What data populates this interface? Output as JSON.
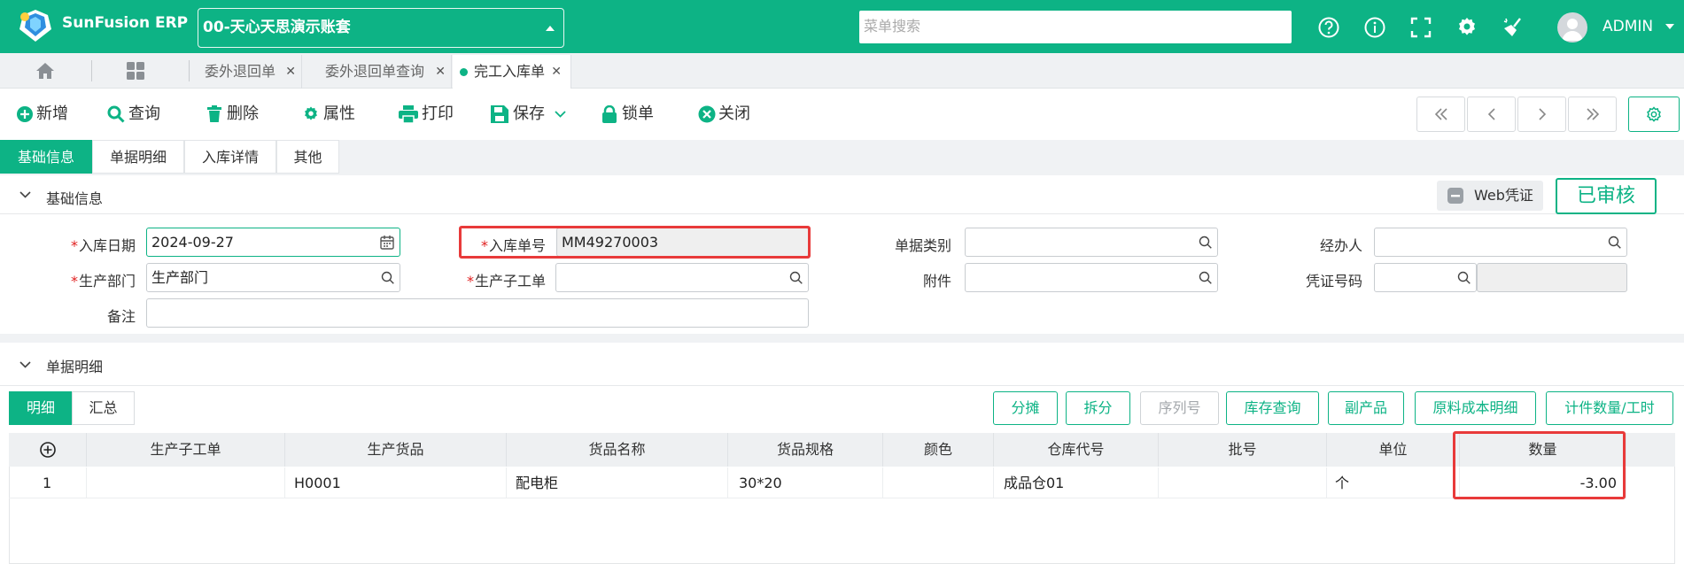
{
  "app": {
    "name": "SunFusion ERP",
    "account": "00-天心天思演示账套"
  },
  "search": {
    "placeholder": "菜单搜索"
  },
  "user": {
    "name": "ADMIN"
  },
  "tabs": [
    {
      "label": "委外退回单"
    },
    {
      "label": "委外退回单查询"
    },
    {
      "label": "完工入库单"
    }
  ],
  "toolbar": {
    "add": "新增",
    "query": "查询",
    "delete": "删除",
    "props": "属性",
    "print": "打印",
    "save": "保存",
    "lock": "锁单",
    "close": "关闭"
  },
  "section_tabs": [
    "基础信息",
    "单据明细",
    "入库详情",
    "其他"
  ],
  "basic": {
    "title": "基础信息",
    "web_voucher": "Web凭证",
    "status": "已审核",
    "labels": {
      "date": "入库日期",
      "order_no": "入库单号",
      "doc_type": "单据类别",
      "handler": "经办人",
      "dept": "生产部门",
      "sub_order": "生产子工单",
      "attachment": "附件",
      "voucher_no": "凭证号码",
      "remark": "备注"
    },
    "values": {
      "date": "2024-09-27",
      "order_no": "MM49270003",
      "doc_type": "",
      "handler": "",
      "dept": "生产部门",
      "sub_order": "",
      "attachment": "",
      "voucher_no": "",
      "remark": ""
    },
    "required_mark": "*"
  },
  "detail": {
    "title": "单据明细",
    "tabs": [
      "明细",
      "汇总"
    ],
    "buttons": [
      "分摊",
      "拆分",
      "序列号",
      "库存查询",
      "副产品",
      "原料成本明细",
      "计件数量/工时"
    ],
    "columns": [
      "生产子工单",
      "生产货品",
      "货品名称",
      "货品规格",
      "颜色",
      "仓库代号",
      "批号",
      "单位",
      "数量"
    ],
    "rows": [
      {
        "no": "1",
        "sub_order": "",
        "product": "H0001",
        "name": "配电柜",
        "spec": "30*20",
        "color": "",
        "warehouse": "成品仓01",
        "batch": "",
        "unit": "个",
        "qty": "-3.00"
      }
    ]
  },
  "colors": {
    "brand": "#0db385",
    "highlight": "#e83a3a"
  }
}
